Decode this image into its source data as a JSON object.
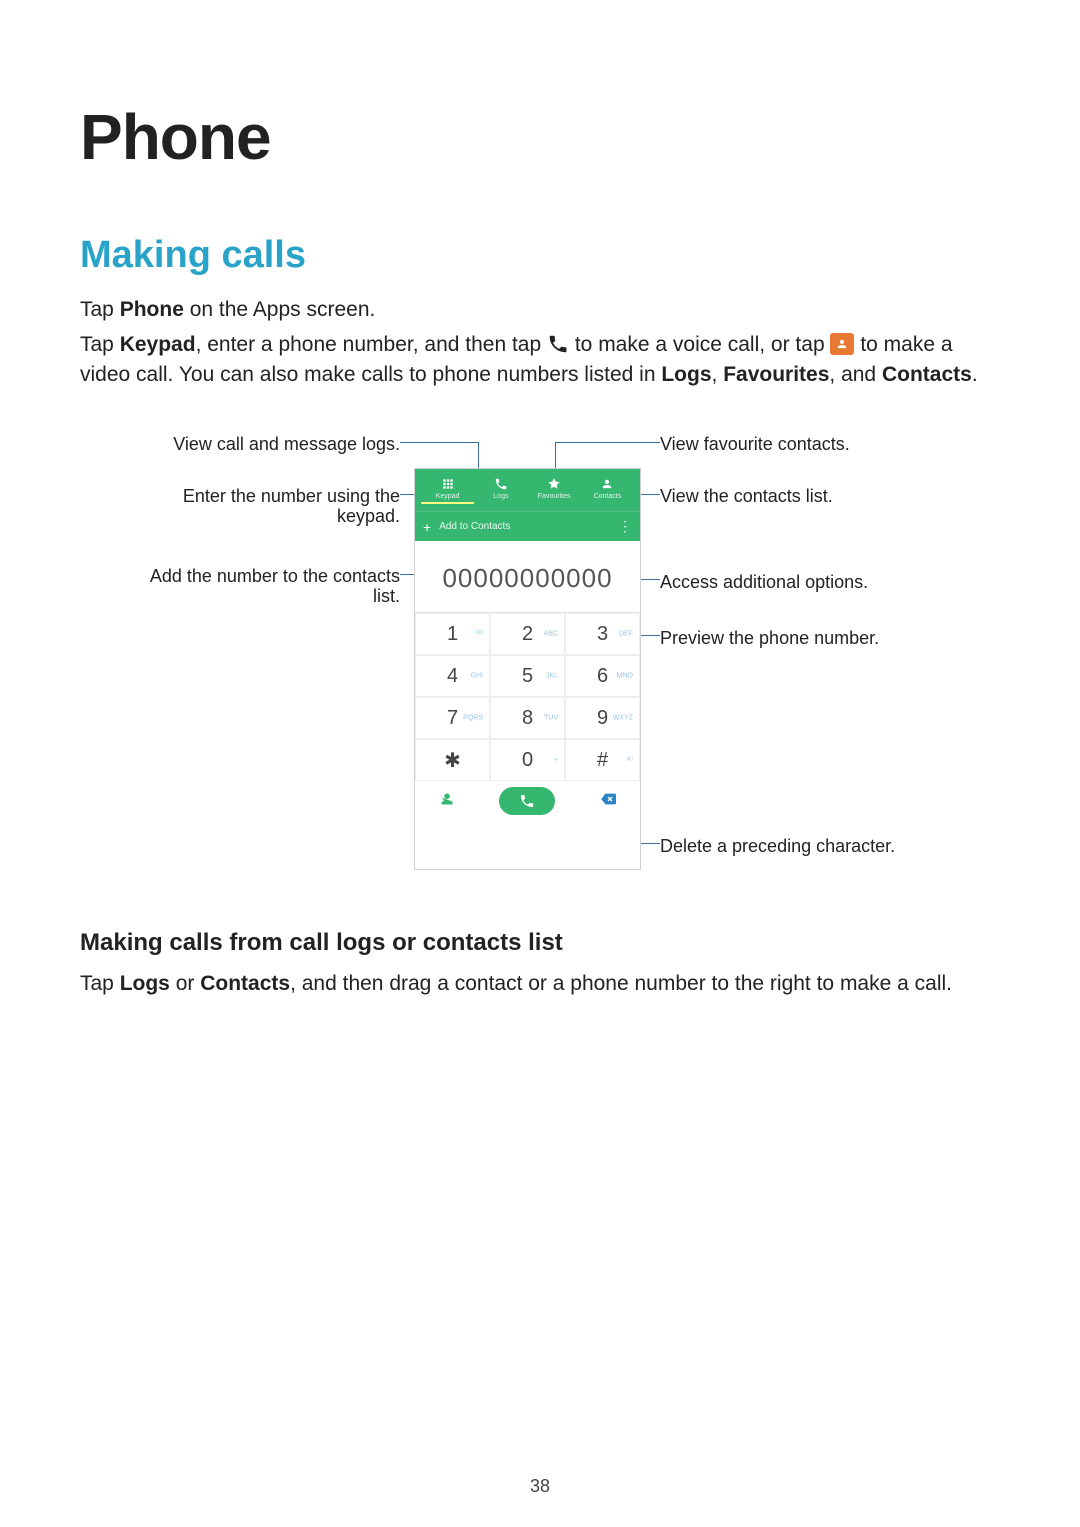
{
  "title": "Phone",
  "section_heading": "Making calls",
  "para1_pre": "Tap ",
  "para1_bold1": "Phone",
  "para1_post": " on the Apps screen.",
  "para2_a": "Tap ",
  "para2_bold_keypad": "Keypad",
  "para2_b": ", enter a phone number, and then tap ",
  "para2_c": " to make a voice call, or tap ",
  "para2_d": " to make a video call. You can also make calls to phone numbers listed in ",
  "para2_bold_logs": "Logs",
  "para2_sep": ", ",
  "para2_bold_fav": "Favourites",
  "para2_and": ", and ",
  "para2_bold_contacts": "Contacts",
  "para2_end": ".",
  "callouts": {
    "left_logs": "View call and message logs.",
    "left_keypad_l1": "Enter the number using the",
    "left_keypad_l2": "keypad.",
    "left_add_l1": "Add the number to the contacts",
    "left_add_l2": "list.",
    "right_fav": "View favourite contacts.",
    "right_contacts": "View the contacts list.",
    "right_options": "Access additional options.",
    "right_preview": "Preview the phone number.",
    "right_delete": "Delete a preceding character."
  },
  "phone": {
    "tabs": [
      "Keypad",
      "Logs",
      "Favourites",
      "Contacts"
    ],
    "add_contacts": "Add to Contacts",
    "number": "00000000000",
    "keys": [
      "1",
      "2",
      "3",
      "4",
      "5",
      "6",
      "7",
      "8",
      "9",
      "✱",
      "0",
      "#"
    ],
    "subs": [
      "ᴼᴼ",
      "ABC",
      "DEF",
      "GHI",
      "JKL",
      "MNO",
      "PQRS",
      "TUV",
      "WXYZ",
      "",
      "+",
      "⁽ᴷ⁾"
    ]
  },
  "sub_heading": "Making calls from call logs or contacts list",
  "para3_a": "Tap ",
  "para3_bold_logs": "Logs",
  "para3_b": " or ",
  "para3_bold_contacts": "Contacts",
  "para3_c": ", and then drag a contact or a phone number to the right to make a call.",
  "page_number": "38"
}
